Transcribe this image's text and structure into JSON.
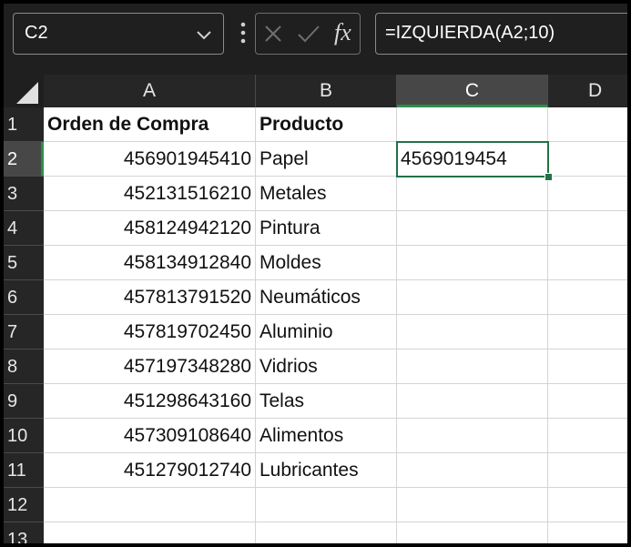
{
  "name_box": {
    "value": "C2"
  },
  "formula_bar": {
    "fx_label": "fx",
    "formula": "=IZQUIERDA(A2;10)"
  },
  "columns": [
    "A",
    "B",
    "C",
    "D"
  ],
  "selected_column": "C",
  "rows": [
    "1",
    "2",
    "3",
    "4",
    "5",
    "6",
    "7",
    "8",
    "9",
    "10",
    "11",
    "12",
    "13"
  ],
  "selected_row": "2",
  "cells": {
    "A1": "Orden de Compra",
    "B1": "Producto",
    "A2": "456901945410",
    "B2": "Papel",
    "C2": "4569019454",
    "A3": "452131516210",
    "B3": "Metales",
    "A4": "458124942120",
    "B4": "Pintura",
    "A5": "458134912840",
    "B5": "Moldes",
    "A6": "457813791520",
    "B6": "Neumáticos",
    "A7": "457819702450",
    "B7": "Aluminio",
    "A8": "457197348280",
    "B8": "Vidrios",
    "A9": "451298643160",
    "B9": "Telas",
    "A10": "457309108640",
    "B10": "Alimentos",
    "A11": "451279012740",
    "B11": "Lubricantes"
  },
  "colors": {
    "accent": "#217346",
    "header_bg": "#262626",
    "toolbar_bg": "#1f1f1f"
  }
}
